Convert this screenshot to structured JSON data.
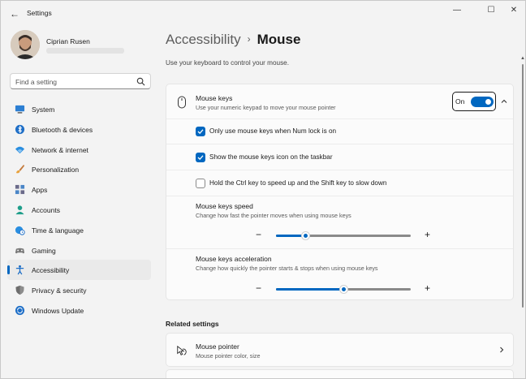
{
  "window": {
    "title": "Settings",
    "back_glyph": "←",
    "minimize_glyph": "—",
    "maximize_glyph": "☐",
    "close_glyph": "✕"
  },
  "user": {
    "name": "Ciprian Rusen"
  },
  "search": {
    "placeholder": "Find a setting",
    "icon": "search-icon"
  },
  "nav": {
    "items": [
      {
        "label": "System",
        "icon": "monitor-icon"
      },
      {
        "label": "Bluetooth & devices",
        "icon": "bluetooth-icon"
      },
      {
        "label": "Network & internet",
        "icon": "wifi-icon"
      },
      {
        "label": "Personalization",
        "icon": "brush-icon"
      },
      {
        "label": "Apps",
        "icon": "apps-icon"
      },
      {
        "label": "Accounts",
        "icon": "person-icon"
      },
      {
        "label": "Time & language",
        "icon": "globe-clock-icon"
      },
      {
        "label": "Gaming",
        "icon": "gamepad-icon"
      },
      {
        "label": "Accessibility",
        "icon": "accessibility-icon",
        "active": true
      },
      {
        "label": "Privacy & security",
        "icon": "shield-icon"
      },
      {
        "label": "Windows Update",
        "icon": "update-icon"
      }
    ]
  },
  "page": {
    "parent": "Accessibility",
    "separator": "›",
    "current": "Mouse",
    "subtitle": "Use your keyboard to control your mouse."
  },
  "mouse_keys": {
    "title": "Mouse keys",
    "description": "Use your numeric keypad to move your mouse pointer",
    "toggle_label": "On",
    "toggle_on": true,
    "options": [
      {
        "label": "Only use mouse keys when Num lock is on",
        "checked": true
      },
      {
        "label": "Show the mouse keys icon on the taskbar",
        "checked": true
      },
      {
        "label": "Hold the Ctrl key to speed up and the Shift key to slow down",
        "checked": false
      }
    ],
    "speed": {
      "title": "Mouse keys speed",
      "description": "Change how fast the pointer moves when using mouse keys",
      "value_fraction": 0.22
    },
    "acceleration": {
      "title": "Mouse keys acceleration",
      "description": "Change how quickly the pointer starts & stops when using mouse keys",
      "value_fraction": 0.5
    },
    "minus_glyph": "−",
    "plus_glyph": "+"
  },
  "related": {
    "title": "Related settings",
    "items": [
      {
        "title": "Mouse pointer",
        "description": "Mouse pointer color, size",
        "icon": "mouse-pointer-icon"
      }
    ]
  },
  "colors": {
    "accent": "#0067c0"
  }
}
